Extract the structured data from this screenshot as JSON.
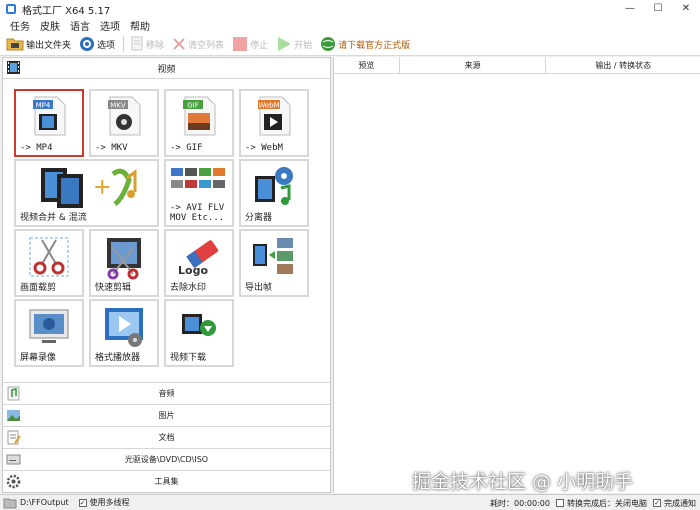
{
  "window": {
    "title": "格式工厂 X64 5.17",
    "minimize": "—",
    "maximize": "☐",
    "close": "✕"
  },
  "menu": [
    "任务",
    "皮肤",
    "语言",
    "选项",
    "帮助"
  ],
  "toolbar": {
    "output_folder": "输出文件夹",
    "options": "选项",
    "remove": "移除",
    "clear_list": "清空列表",
    "stop": "停止",
    "start": "开始",
    "download_official": "请下载官方正式版"
  },
  "video": {
    "header": "视频",
    "tiles": [
      {
        "label": "-> MP4",
        "badge": "MP4"
      },
      {
        "label": "-> MKV",
        "badge": "MKV"
      },
      {
        "label": "-> GIF",
        "badge": "GIF"
      },
      {
        "label": "-> WebM",
        "badge": "WebM"
      },
      {
        "label": "视频合并 & 混流"
      },
      {
        "label": "-> AVI FLV\nMOV Etc..."
      },
      {
        "label": "分离器"
      },
      {
        "label": "画面载剪"
      },
      {
        "label": "快速剪辑"
      },
      {
        "label": "去除水印",
        "logo": "Logo"
      },
      {
        "label": "导出帧"
      },
      {
        "label": "屏幕录像"
      },
      {
        "label": "格式播放器"
      },
      {
        "label": "视频下载"
      }
    ]
  },
  "categories": [
    "音频",
    "图片",
    "文档",
    "光驱设备\\DVD\\CD\\ISO",
    "工具集"
  ],
  "list": {
    "col_preview": "预览",
    "col_source": "来源",
    "col_output": "输出 / 转换状态"
  },
  "status": {
    "path": "D:\\FFOutput",
    "multithread": "使用多线程",
    "elapsed_label": "耗时：00:00:00",
    "after_done_label": "转换完成后：关闭电脑",
    "notify_label": "完成通知"
  },
  "watermark": "掘金技术社区 @ 小明助手",
  "colors": {
    "selected_border": "#d03a2a",
    "link": "#b05a00"
  }
}
